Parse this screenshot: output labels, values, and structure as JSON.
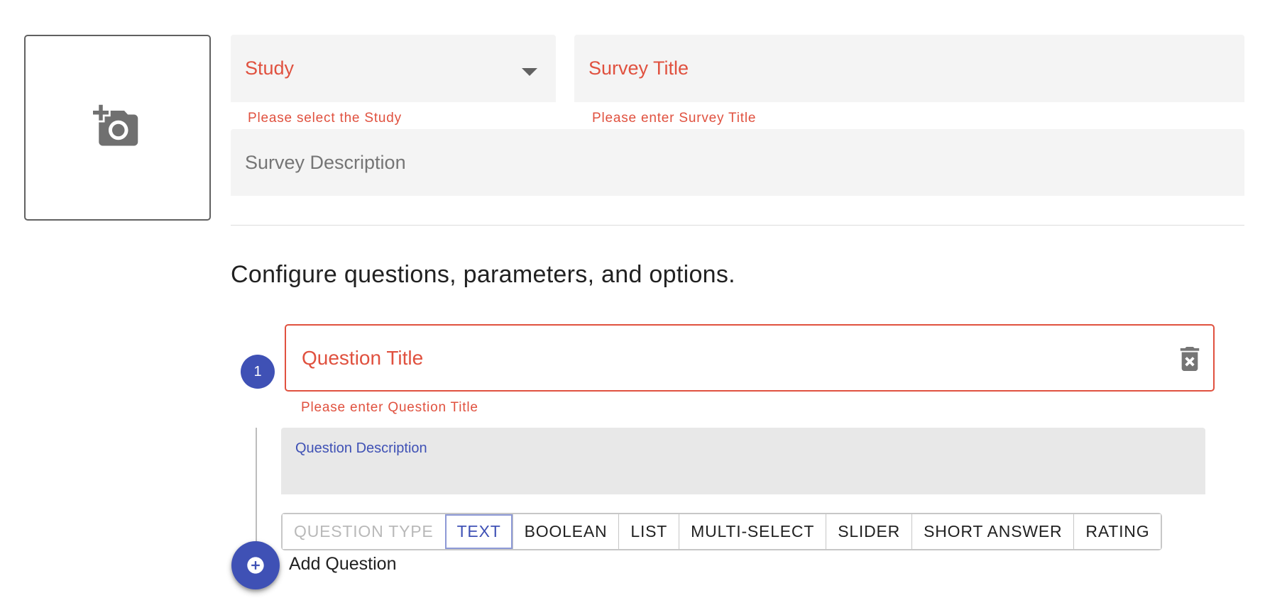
{
  "form": {
    "image_upload": {
      "icon": "add-a-photo-icon"
    },
    "study": {
      "placeholder": "Study",
      "helper": "Please select the Study",
      "icon": "arrow-drop-down-icon"
    },
    "survey_title": {
      "placeholder": "Survey Title",
      "helper": "Please enter Survey Title"
    },
    "survey_description": {
      "placeholder": "Survey Description"
    }
  },
  "section": {
    "heading": "Configure questions, parameters, and options."
  },
  "question": {
    "number": "1",
    "title_placeholder": "Question Title",
    "title_helper": "Please enter Question Title",
    "delete_icon": "delete-forever-icon",
    "description_label": "Question Description",
    "type_group": {
      "label": "QUESTION TYPE",
      "options": [
        "TEXT",
        "BOOLEAN",
        "LIST",
        "MULTI-SELECT",
        "SLIDER",
        "SHORT ANSWER",
        "RATING"
      ],
      "selected": "TEXT"
    }
  },
  "add_question": {
    "label": "Add Question",
    "icon": "add-circle-icon"
  },
  "colors": {
    "primary": "#3f51b5",
    "error": "#e0513f",
    "field_bg": "#f4f4f4"
  }
}
